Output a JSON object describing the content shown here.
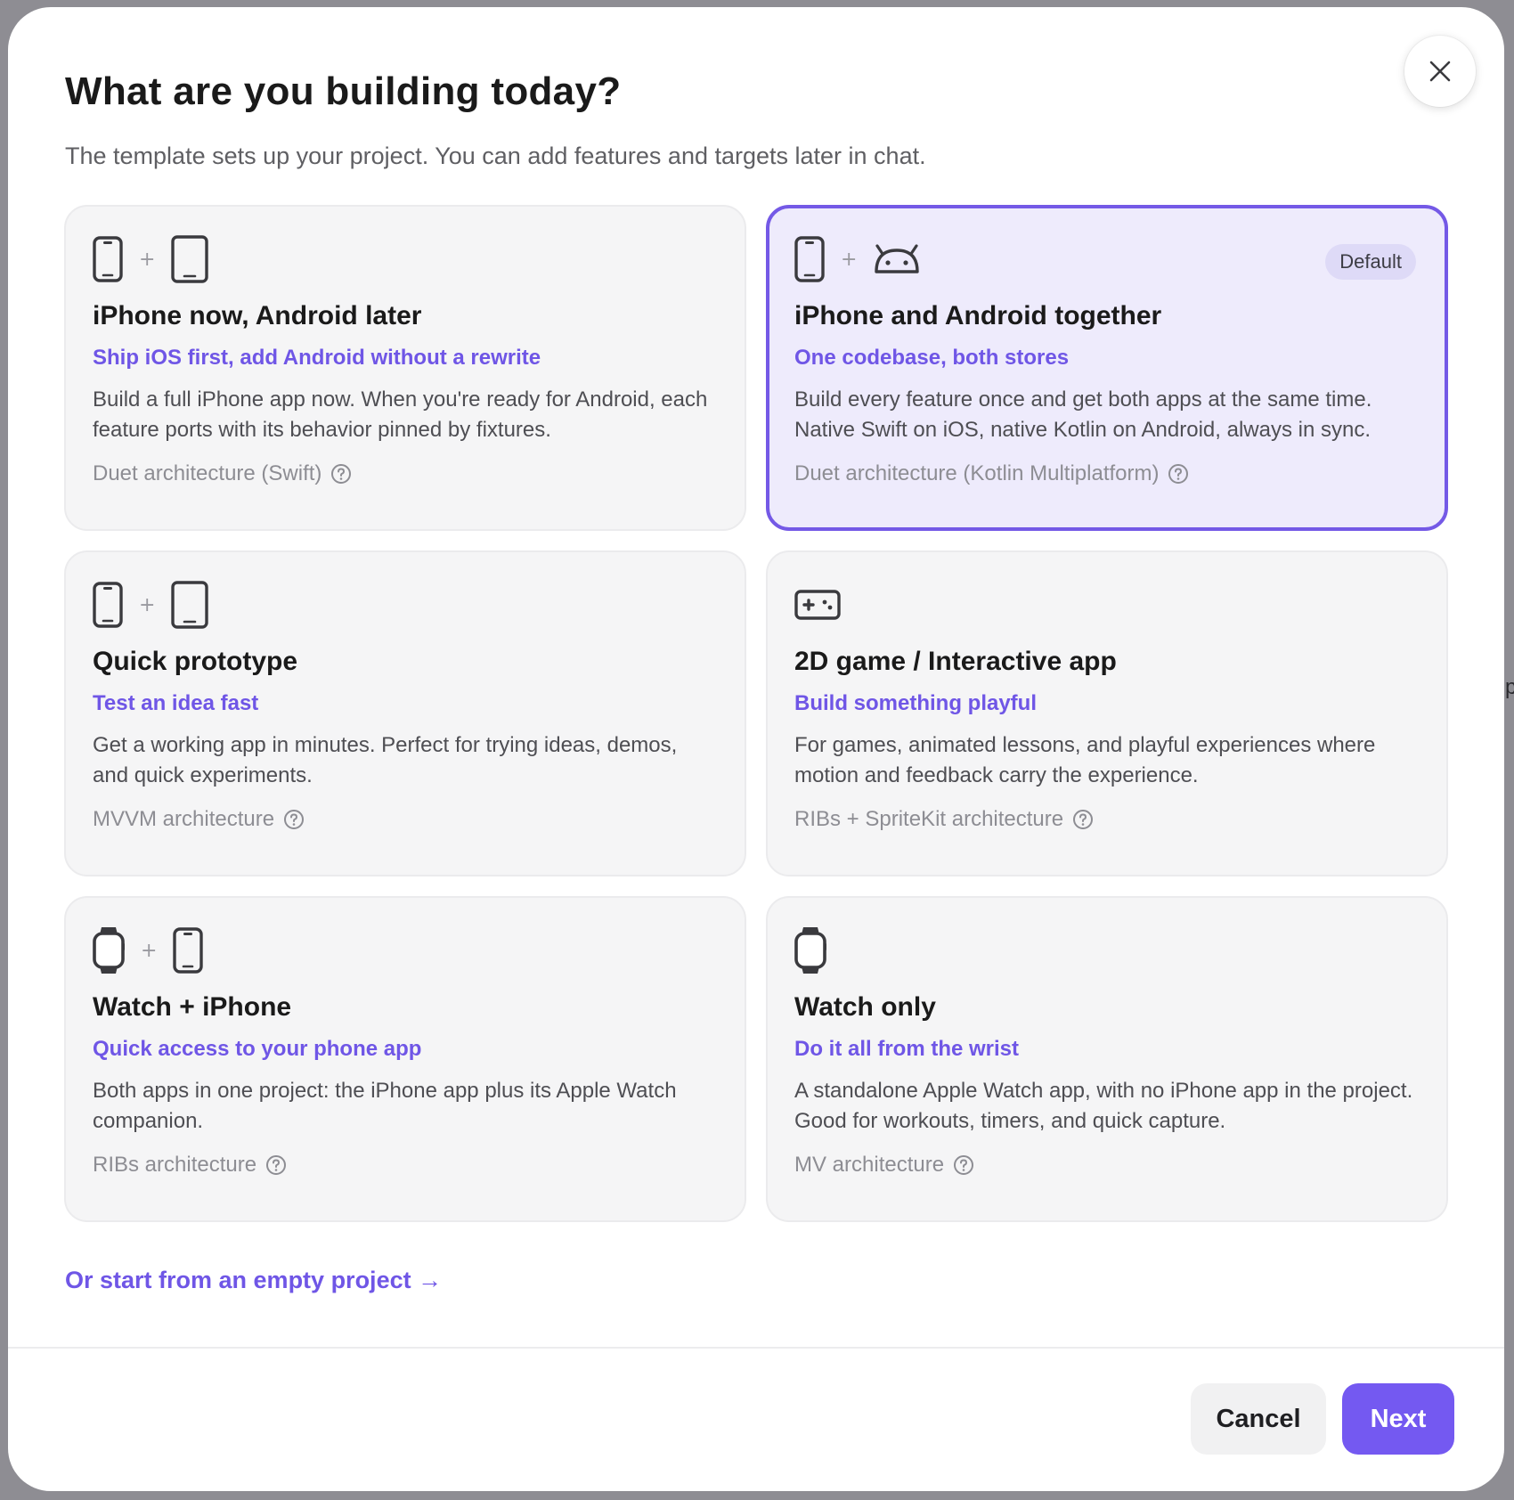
{
  "dialog": {
    "title": "What are you building today?",
    "subtitle": "The template sets up your project. You can add features and targets later in chat.",
    "close_icon": "close-icon"
  },
  "templates": [
    {
      "title": "iPhone now, Android later",
      "tagline": "Ship iOS first, add Android without a rewrite",
      "description": "Build a full iPhone app now. When you're ready for Android, each feature ports with its behavior pinned by fixtures.",
      "architecture": "Duet architecture (Swift)",
      "icons": [
        "phone-icon",
        "android-phone-icon"
      ],
      "selected": false
    },
    {
      "title": "iPhone and Android together",
      "tagline": "One codebase, both stores",
      "description": "Build every feature once and get both apps at the same time. Native Swift on iOS, native Kotlin on Android, always in sync.",
      "architecture": "Duet architecture (Kotlin Multiplatform)",
      "icons": [
        "phone-icon",
        "android-icon"
      ],
      "badge": "Default",
      "selected": true
    },
    {
      "title": "Quick prototype",
      "tagline": "Test an idea fast",
      "description": "Get a working app in minutes. Perfect for trying ideas, demos, and quick experiments.",
      "architecture": "MVVM architecture",
      "icons": [
        "phone-icon",
        "android-phone-icon"
      ],
      "selected": false
    },
    {
      "title": "2D game / Interactive app",
      "tagline": "Build something playful",
      "description": "For games, animated lessons, and playful experiences where motion and feedback carry the experience.",
      "architecture": "RIBs + SpriteKit architecture",
      "icons": [
        "gamepad-icon"
      ],
      "selected": false
    },
    {
      "title": "Watch + iPhone",
      "tagline": "Quick access to your phone app",
      "description": "Both apps in one project: the iPhone app plus its Apple Watch companion.",
      "architecture": "RIBs architecture",
      "icons": [
        "watch-icon",
        "phone-icon"
      ],
      "selected": false
    },
    {
      "title": "Watch only",
      "tagline": "Do it all from the wrist",
      "description": "A standalone Apple Watch app, with no iPhone app in the project. Good for workouts, timers, and quick capture.",
      "architecture": "MV architecture",
      "icons": [
        "watch-icon"
      ],
      "selected": false
    }
  ],
  "icon_plus": "+",
  "empty_project_link": "Or start from an empty project →",
  "footer": {
    "cancel_label": "Cancel",
    "next_label": "Next"
  },
  "colors": {
    "accent": "#7459f1",
    "selected_bg": "#eeebfc",
    "card_bg": "#f5f5f6"
  }
}
